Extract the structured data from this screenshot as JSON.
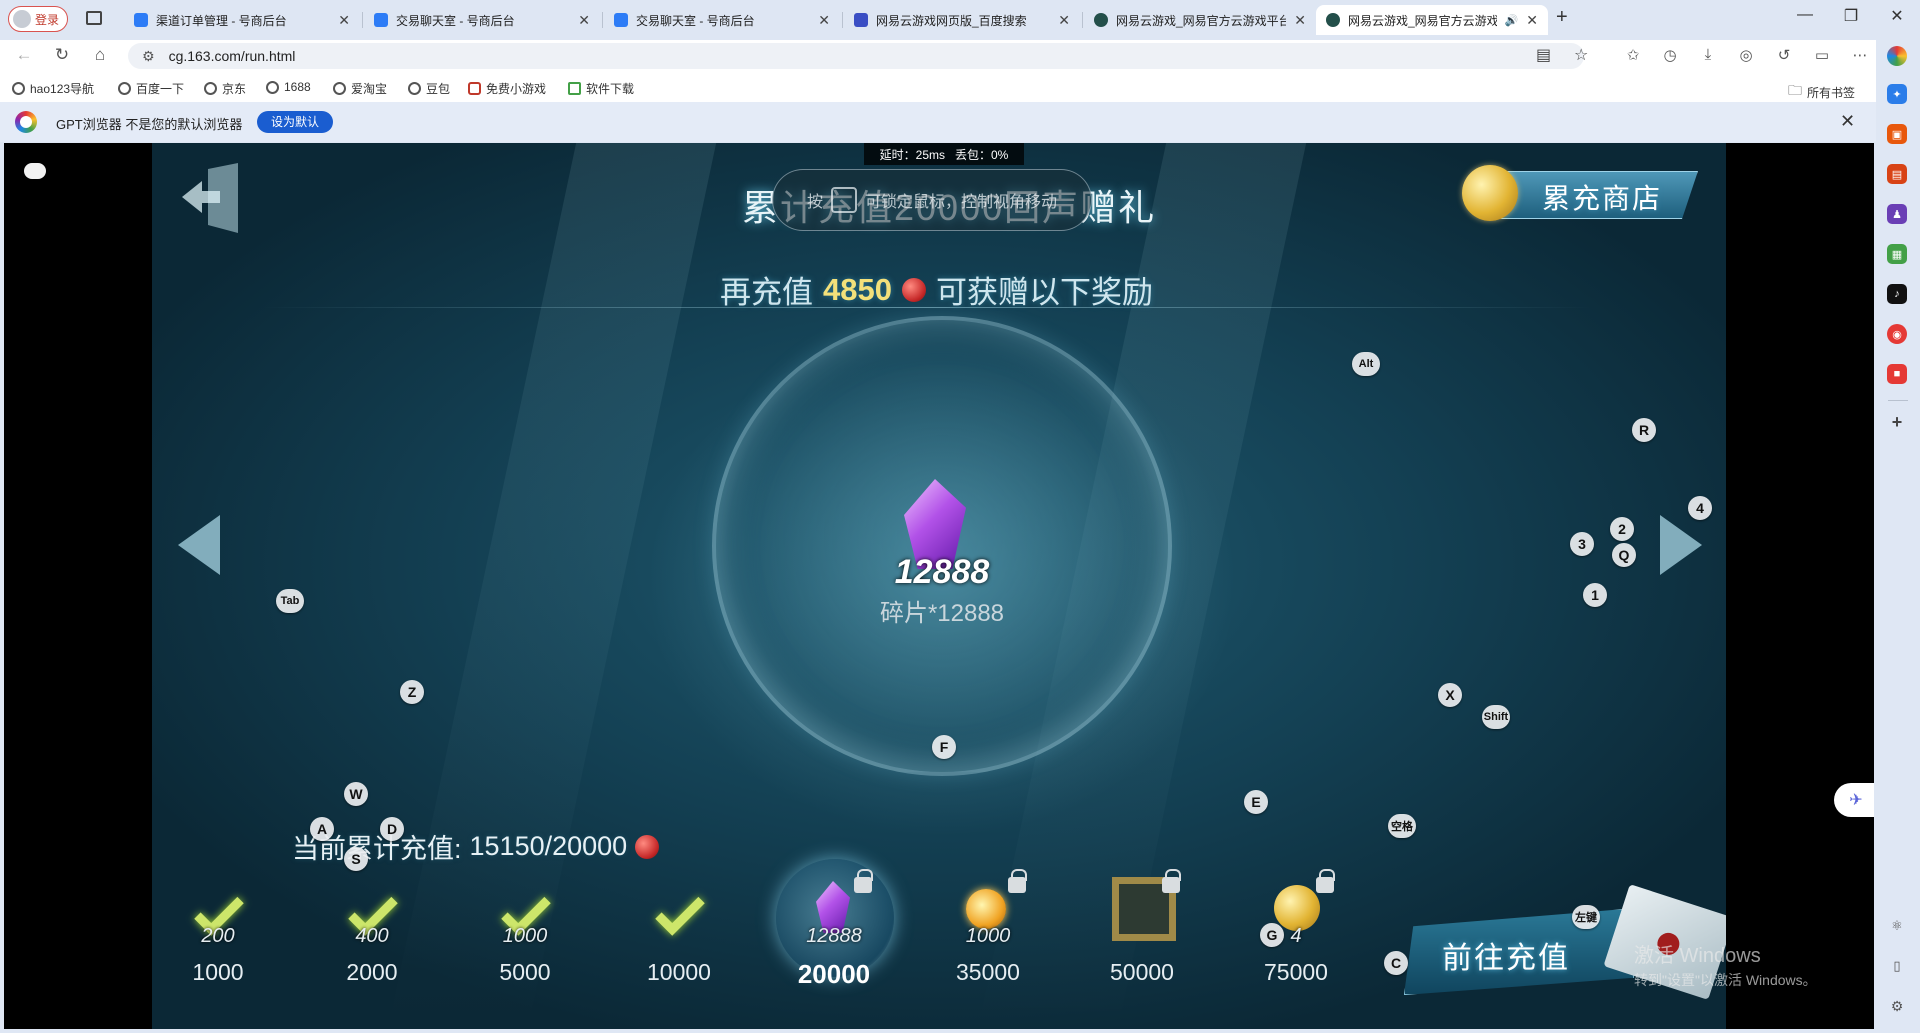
{
  "browser": {
    "profile_label": "登录",
    "tabs": [
      {
        "title": "渠道订单管理 - 号商后台",
        "favicon_color": "#2d7cf6"
      },
      {
        "title": "交易聊天室 - 号商后台",
        "favicon_color": "#2d7cf6"
      },
      {
        "title": "交易聊天室 - 号商后台",
        "favicon_color": "#2d7cf6"
      },
      {
        "title": "网易云游戏网页版_百度搜索",
        "favicon_color": "#3a4ec4"
      },
      {
        "title": "网易云游戏_网易官方云游戏平台",
        "favicon_color": "#234f4a"
      },
      {
        "title": "网易云游戏_网易官方云游戏",
        "favicon_color": "#234f4a"
      }
    ],
    "url": "cg.163.com/run.html",
    "bookmarks": [
      "hao123导航",
      "百度一下",
      "京东",
      "1688",
      "爱淘宝",
      "豆包",
      "免费小游戏",
      "软件下载"
    ],
    "bookmarks_folder": "所有书签",
    "infobar": {
      "message": "GPT浏览器 不是您的默认浏览器",
      "button": "设为默认"
    }
  },
  "game": {
    "stats": {
      "latency": "延时：25ms",
      "loss": "丢包：0%"
    },
    "title": "累计充值20000回声赠礼",
    "lock_hint": {
      "prefix": "按",
      "text": "可锁定鼠标，控制视角移动"
    },
    "shop_label": "累充商店",
    "recharge": {
      "prefix": "再充值",
      "amount": "4850",
      "suffix": "可获赠以下奖励"
    },
    "reward": {
      "amount": "12888",
      "name": "碎片*12888"
    },
    "current": {
      "label": "当前累计充值:",
      "value": "15150/20000"
    },
    "milestones": [
      {
        "reward": "200",
        "value": "1000",
        "claimed": true
      },
      {
        "reward": "400",
        "value": "2000",
        "claimed": true
      },
      {
        "reward": "1000",
        "value": "5000",
        "claimed": true
      },
      {
        "reward": "",
        "value": "10000",
        "claimed": true
      },
      {
        "reward": "12888",
        "value": "20000",
        "claimed": false
      },
      {
        "reward": "1000",
        "value": "35000",
        "claimed": false
      },
      {
        "reward": "",
        "value": "50000",
        "claimed": false
      },
      {
        "reward": "4",
        "value": "75000",
        "claimed": false
      }
    ],
    "go_button": "前往充值",
    "keys": [
      "Alt",
      "R",
      "4",
      "2",
      "3",
      "Q",
      "1",
      "Tab",
      "Z",
      "X",
      "Shift",
      "F",
      "W",
      "E",
      "空格",
      "A",
      "D",
      "S",
      "G",
      "C",
      "左键"
    ]
  },
  "watermark": {
    "line1": "激活 Windows",
    "line2": "转到\"设置\"以激活 Windows。"
  }
}
